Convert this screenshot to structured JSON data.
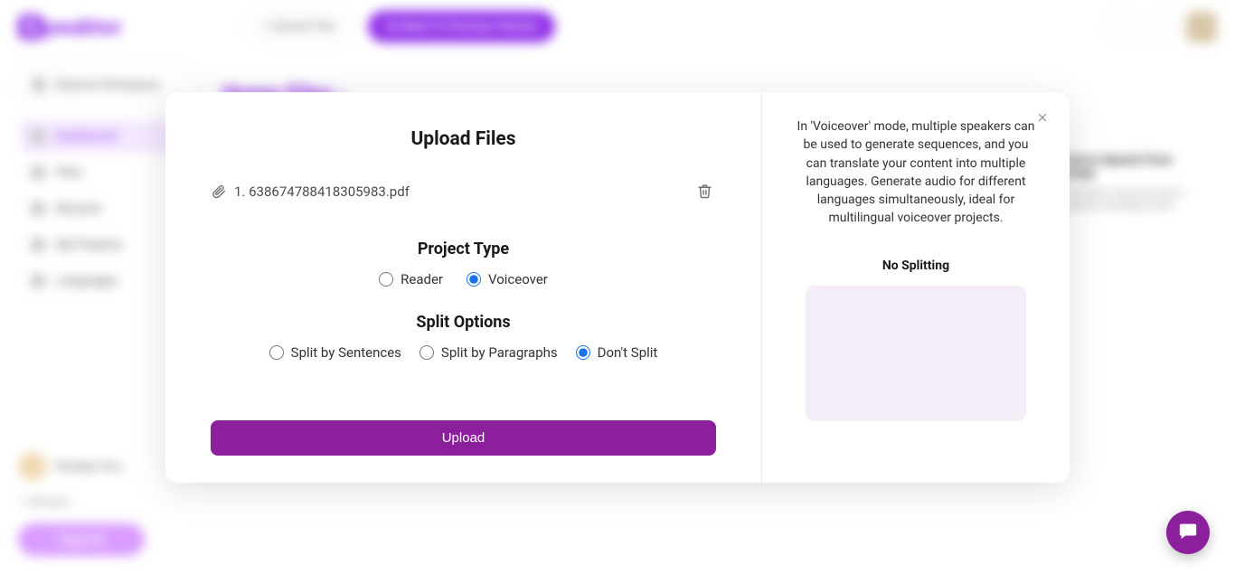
{
  "bg": {
    "brand": "peaktor",
    "brand_prefix": "S",
    "upload_pill": "+  Upload Files",
    "cta": "Go Back To Previous Version",
    "workspace": "Rubina's Workspace",
    "nav": [
      "Dashboard",
      "Files",
      "Recents",
      "My Projects",
      "Languages"
    ],
    "user": "Rosalya You…",
    "minutes": "⏱ Minutes",
    "upgrade": "Upgrade",
    "home_title": "Home Files ›",
    "card_title": "Text to Speech From Script",
    "card_body": "Transform any text into a natural-sounding voice"
  },
  "modal": {
    "title": "Upload Files",
    "file_prefix": "1. ",
    "file_name": "638674788418305983.pdf",
    "project_type_label": "Project Type",
    "pt_reader": "Reader",
    "pt_voiceover": "Voiceover",
    "split_label": "Split Options",
    "split_sentences": "Split by Sentences",
    "split_paragraphs": "Split by Paragraphs",
    "split_none": "Don't Split",
    "upload_btn": "Upload",
    "info": "In 'Voiceover' mode, multiple speakers can be used to generate sequences, and you can translate your content into multiple languages. Generate audio for different languages simultaneously, ideal for multilingual voiceover projects.",
    "nosplit": "No Splitting"
  }
}
